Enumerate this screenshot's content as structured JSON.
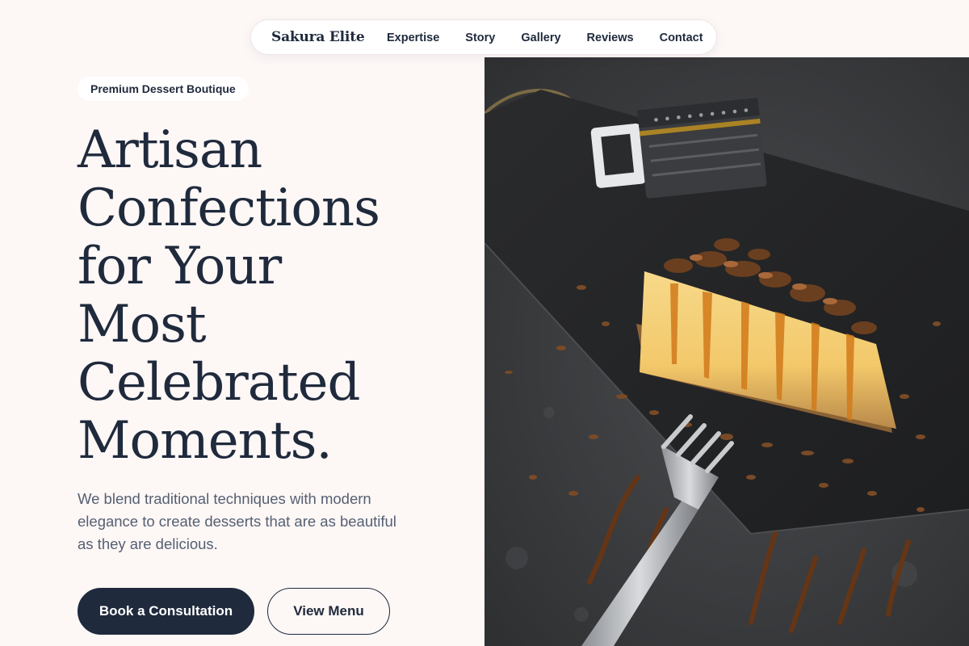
{
  "nav": {
    "brand": "Sakura Elite",
    "links": [
      "Expertise",
      "Story",
      "Gallery",
      "Reviews",
      "Contact"
    ]
  },
  "hero": {
    "badge": "Premium Dessert Boutique",
    "headline_lines": [
      "Artisan",
      "Confections",
      "for Your",
      "Most",
      "Celebrated",
      "Moments."
    ],
    "subtext": "We blend traditional techniques with modern elegance to create desserts that are as beautiful as they are delicious.",
    "primary_cta": "Book a Consultation",
    "secondary_cta": "View Menu"
  },
  "colors": {
    "page_background": "#fdf7f6",
    "navy": "#1f2a3c",
    "muted_text": "#556072",
    "photo_background": "#3a3b3d",
    "caramel": "#e0963a"
  },
  "icons": {
    "photo": "cheesecake-photo"
  }
}
